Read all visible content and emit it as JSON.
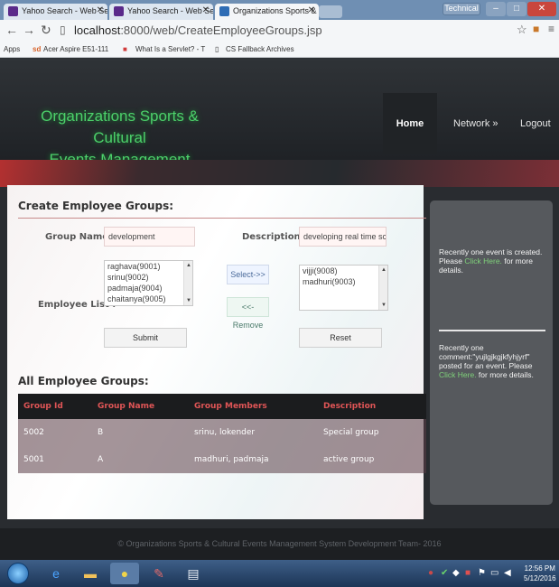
{
  "browser": {
    "tabs": [
      {
        "label": "Yahoo Search - Web Sear",
        "icon": "yahoo-icon"
      },
      {
        "label": "Yahoo Search - Web Sear",
        "icon": "yahoo-icon"
      },
      {
        "label": "Organizations Sports & C",
        "icon": "page-icon"
      }
    ],
    "user": "Technical",
    "url_host": "localhost",
    "url_path": ":8000/web/CreateEmployeeGroups.jsp",
    "bookmarks": [
      "Apps",
      "Acer Aspire E51-111",
      "What Is a Servlet? - T",
      "CS Fallback Archives"
    ]
  },
  "header": {
    "brand_line1": "Organizations Sports & Cultural",
    "brand_line2": "Events Management System",
    "nav": {
      "home": "Home",
      "network": "Network »",
      "logout": "Logout"
    }
  },
  "create": {
    "title": "Create Employee Groups:",
    "group_name_label": "Group Name:",
    "group_name_value": "development",
    "description_label": "Description :",
    "description_value": "developing real time scena",
    "employee_list_label": "Employee List :",
    "available": [
      "raghava(9001)",
      "srinu(9002)",
      "padmaja(9004)",
      "chaitanya(9005)"
    ],
    "selected": [
      "vijji(9008)",
      "madhuri(9003)"
    ],
    "select_btn": "Select->>",
    "remove_btn": "<<-Remove",
    "submit_btn": "Submit",
    "reset_btn": "Reset"
  },
  "groups": {
    "title": "All Employee Groups:",
    "columns": [
      "Group Id",
      "Group Name",
      "Group Members",
      "Description"
    ],
    "rows": [
      {
        "id": "5002",
        "name": "B",
        "members": "srinu, lokender",
        "description": "Special group"
      },
      {
        "id": "5001",
        "name": "A",
        "members": "madhuri, padmaja",
        "description": "active group"
      }
    ]
  },
  "sidebar": {
    "notice1_pre": "Recently one event is created. Please ",
    "notice1_link": "Click Here.",
    "notice1_post": " for more details.",
    "notice2_pre": "Recently one comment:\"yujlgjkgjkfyhjyrf\" posted for an event. Please ",
    "notice2_link": "Click Here.",
    "notice2_post": " for more details."
  },
  "footer": "© Organizations Sports & Cultural Events Management System Development Team- 2016",
  "taskbar": {
    "time": "12:56 PM",
    "date": "5/12/2016"
  }
}
